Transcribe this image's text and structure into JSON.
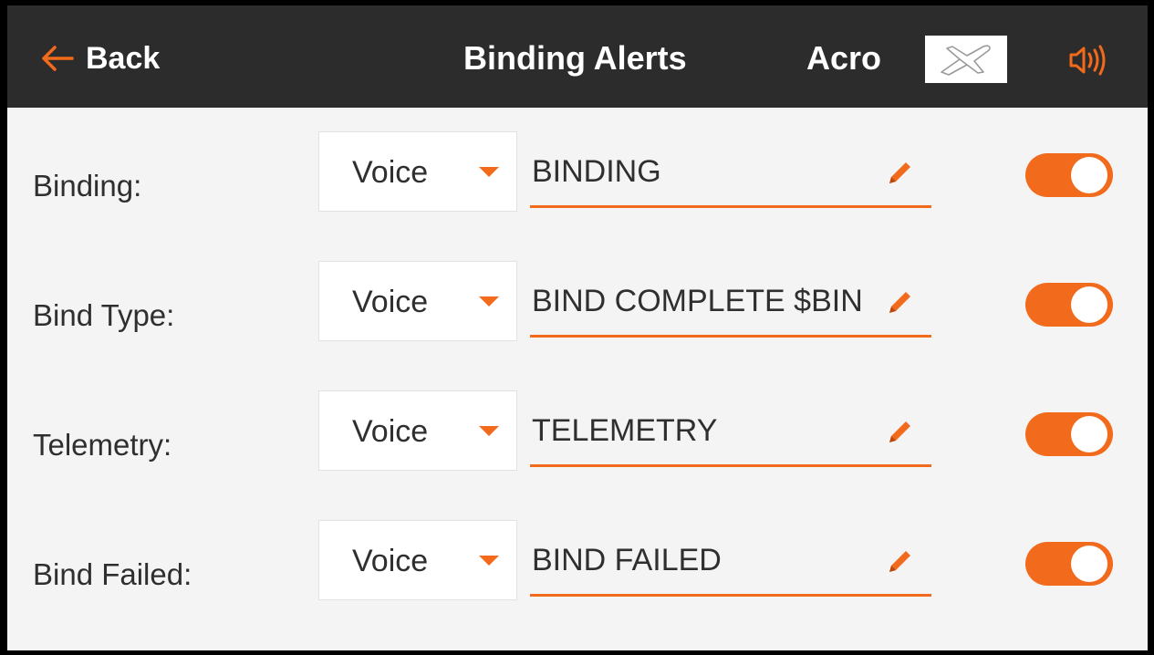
{
  "header": {
    "back_label": "Back",
    "title": "Binding Alerts",
    "model_name": "Acro"
  },
  "icons": {
    "back": "arrow-left-icon",
    "model": "airplane-icon",
    "speaker": "speaker-icon",
    "edit": "pencil-icon",
    "dropdown": "caret-down-icon"
  },
  "colors": {
    "accent": "#f26a1b",
    "header_bg": "#2c2c2c",
    "content_bg": "#f4f4f4"
  },
  "alerts": [
    {
      "label": "Binding:",
      "mode": "Voice",
      "text": "BINDING",
      "enabled": true
    },
    {
      "label": "Bind Type:",
      "mode": "Voice",
      "text": "BIND COMPLETE $BIN",
      "enabled": true
    },
    {
      "label": "Telemetry:",
      "mode": "Voice",
      "text": "TELEMETRY",
      "enabled": true
    },
    {
      "label": "Bind Failed:",
      "mode": "Voice",
      "text": "BIND FAILED",
      "enabled": true
    }
  ]
}
